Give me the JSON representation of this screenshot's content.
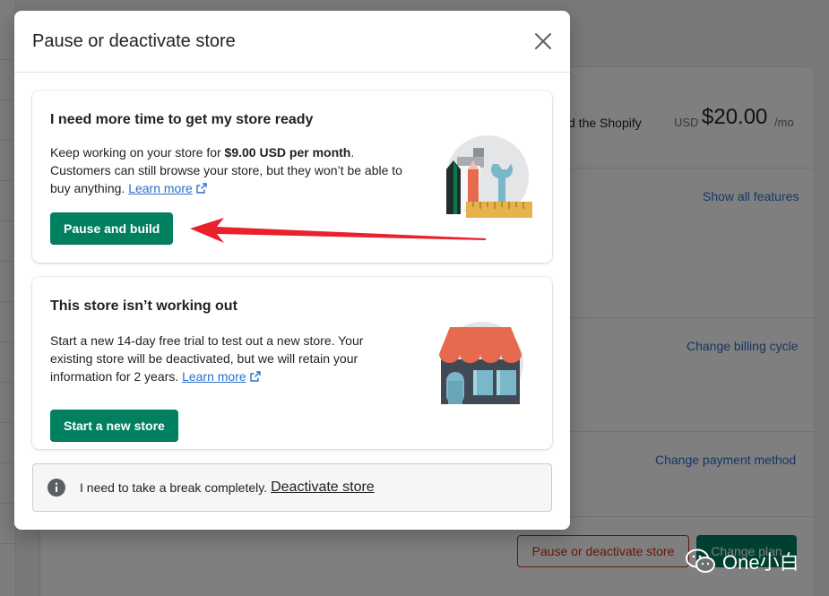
{
  "background": {
    "plan_text_partial": "d the Shopify",
    "price_currency": "USD",
    "price_value": "$20.00",
    "price_unit": "/mo",
    "links": {
      "show_all_features": "Show all features",
      "change_billing_cycle": "Change billing cycle",
      "change_payment_method": "Change payment method"
    },
    "buttons": {
      "pause_or_deactivate": "Pause or deactivate store",
      "change_plan": "Change plan"
    }
  },
  "modal": {
    "title": "Pause or deactivate store",
    "cards": [
      {
        "title": "I need more time to get my store ready",
        "body_prefix": "Keep working on your store for ",
        "body_bold": "$9.00 USD per month",
        "body_suffix": ". Customers can still browse your store, but they won’t be able to buy anything.",
        "link_label": "Learn more",
        "button_label": "Pause and build",
        "illustration": "tools-illustration"
      },
      {
        "title": "This store isn’t working out",
        "body_prefix": "Start a new 14-day free trial to test out a new store. Your existing store will be deactivated, but we will retain your information for 2 years.",
        "link_label": "Learn more",
        "button_label": "Start a new store",
        "illustration": "storefront-illustration"
      }
    ],
    "banner": {
      "text": "I need to take a break completely.",
      "link_label": "Deactivate store",
      "icon": "info-icon"
    }
  },
  "watermark": {
    "text": "One小白",
    "icon": "wechat-icon"
  },
  "annotation": {
    "icon": "red-arrow"
  },
  "colors": {
    "primary_green": "#008060",
    "link_blue": "#2c6ecb",
    "critical_red": "#d72c0d",
    "arrow_red": "#e8212c"
  }
}
